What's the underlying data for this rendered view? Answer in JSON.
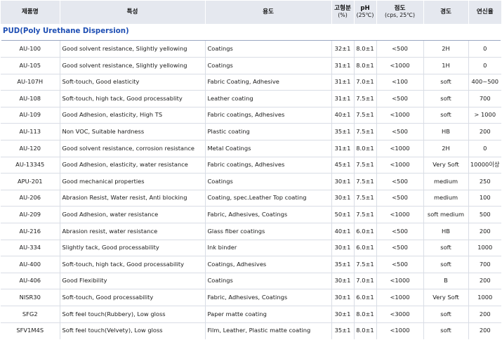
{
  "headers": {
    "product": "제품명",
    "feature": "특성",
    "usage": "용도",
    "solid": "고형분",
    "solid_unit": "(%)",
    "ph": "pH",
    "ph_unit": "(25℃)",
    "viscosity": "점도",
    "viscosity_unit": "(cps, 25℃)",
    "hardness": "경도",
    "elongation": "연신율"
  },
  "section_title": "PUD(Poly Urethane Dispersion)",
  "rows": [
    {
      "product": "AU-100",
      "feature": "Good solvent resistance, Slightly yellowing",
      "usage": "Coatings",
      "solid": "32±1",
      "ph": "8.0±1",
      "viscosity": "<500",
      "hardness": "2H",
      "elongation": "0"
    },
    {
      "product": "AU-105",
      "feature": "Good solvent resistance, Slightly yellowing",
      "usage": "Coatings",
      "solid": "31±1",
      "ph": "8.0±1",
      "viscosity": "<1000",
      "hardness": "1H",
      "elongation": "0"
    },
    {
      "product": "AU-107H",
      "feature": "Soft-touch, Good elasticity",
      "usage": "Fabric Coating, Adhesive",
      "solid": "31±1",
      "ph": "7.0±1",
      "viscosity": "<100",
      "hardness": "soft",
      "elongation": "400~500"
    },
    {
      "product": "AU-108",
      "feature": "Soft-touch, high tack, Good processablity",
      "usage": "Leather coating",
      "solid": "31±1",
      "ph": "7.5±1",
      "viscosity": "<500",
      "hardness": "soft",
      "elongation": "700"
    },
    {
      "product": "AU-109",
      "feature": "Good Adhesion, elasticity, High TS",
      "usage": "Fabric coatings, Adhesives",
      "solid": "40±1",
      "ph": "7.5±1",
      "viscosity": "<1000",
      "hardness": "soft",
      "elongation": "> 1000"
    },
    {
      "product": "AU-113",
      "feature": "Non VOC, Suitable hardness",
      "usage": "Plastic coating",
      "solid": "35±1",
      "ph": "7.5±1",
      "viscosity": "<500",
      "hardness": "HB",
      "elongation": "200"
    },
    {
      "product": "AU-120",
      "feature": "Good solvent resistance, corrosion resistance",
      "usage": "Metal Coatings",
      "solid": "31±1",
      "ph": "8.0±1",
      "viscosity": "<1000",
      "hardness": "2H",
      "elongation": "0"
    },
    {
      "product": "AU-13345",
      "feature": "Good Adhesion, elasticity, water resistance",
      "usage": "Fabric coatings, Adhesives",
      "solid": "45±1",
      "ph": "7.5±1",
      "viscosity": "<1000",
      "hardness": "Very Soft",
      "elongation": "10000이상"
    },
    {
      "product": "APU-201",
      "feature": "Good mechanical properties",
      "usage": "Coatings",
      "solid": "30±1",
      "ph": "7.5±1",
      "viscosity": "<500",
      "hardness": "medium",
      "elongation": "250"
    },
    {
      "product": "AU-206",
      "feature": "Abrasion Resist, Water resist, Anti blocking",
      "usage": "Coating, spec.Leather Top coating",
      "solid": "30±1",
      "ph": "7.5±1",
      "viscosity": "<500",
      "hardness": "medium",
      "elongation": "100"
    },
    {
      "product": "AU-209",
      "feature": "Good Adhesion, water resistance",
      "usage": "Fabric, Adhesives, Coatings",
      "solid": "50±1",
      "ph": "7.5±1",
      "viscosity": "<1000",
      "hardness": "soft medium",
      "elongation": "500"
    },
    {
      "product": "AU-216",
      "feature": "Abrasion resist, water resistance",
      "usage": "Glass fiber coatings",
      "solid": "40±1",
      "ph": "6.0±1",
      "viscosity": "<500",
      "hardness": "HB",
      "elongation": "200"
    },
    {
      "product": "AU-334",
      "feature": "Slightly tack, Good processability",
      "usage": "Ink binder",
      "solid": "30±1",
      "ph": "6.0±1",
      "viscosity": "<500",
      "hardness": "soft",
      "elongation": "1000"
    },
    {
      "product": "AU-400",
      "feature": "Soft-touch, high tack, Good processability",
      "usage": "Coatings, Adhesives",
      "solid": "35±1",
      "ph": "7.5±1",
      "viscosity": "<500",
      "hardness": "soft",
      "elongation": "700"
    },
    {
      "product": "AU-406",
      "feature": "Good Flexibility",
      "usage": "Coatings",
      "solid": "30±1",
      "ph": "7.0±1",
      "viscosity": "<1000",
      "hardness": "B",
      "elongation": "200"
    },
    {
      "product": "NISR30",
      "feature": "Soft-touch, Good processability",
      "usage": "Fabric, Adhesives, Coatings",
      "solid": "30±1",
      "ph": "6.0±1",
      "viscosity": "<1000",
      "hardness": "Very Soft",
      "elongation": "1000"
    },
    {
      "product": "SFG2",
      "feature": "Soft feel touch(Rubbery), Low gloss",
      "usage": "Paper matte coating",
      "solid": "30±1",
      "ph": "8.0±1",
      "viscosity": "<3000",
      "hardness": "soft",
      "elongation": "200"
    },
    {
      "product": "SFV1M4S",
      "feature": "Soft feel touch(Velvety), Low gloss",
      "usage": "Film, Leather, Plastic matte coating",
      "solid": "35±1",
      "ph": "8.0±1",
      "viscosity": "<1000",
      "hardness": "soft",
      "elongation": "200"
    }
  ]
}
